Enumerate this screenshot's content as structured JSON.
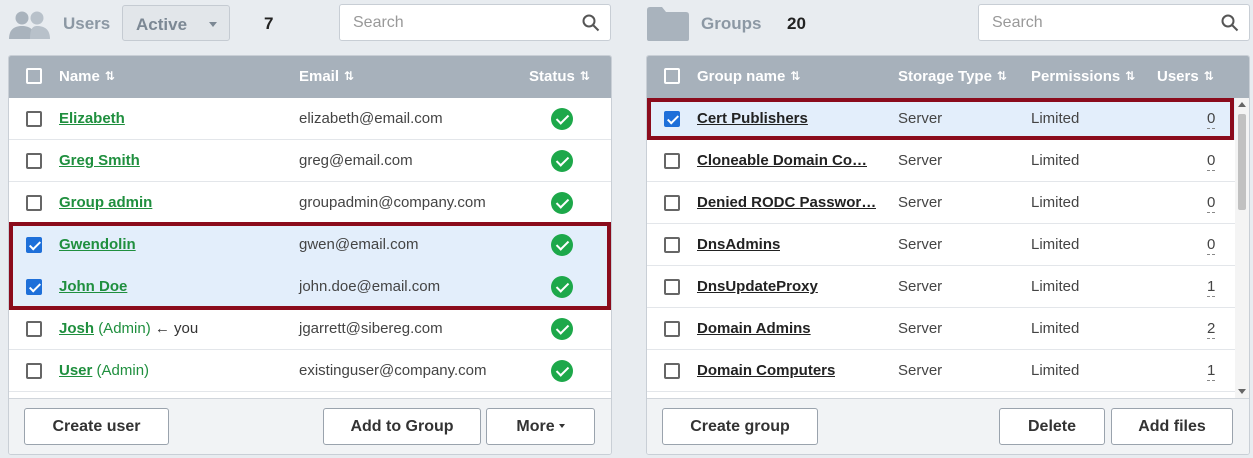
{
  "users_panel": {
    "title": "Users",
    "filter": {
      "selected": "Active"
    },
    "count": "7",
    "search": {
      "placeholder": "Search",
      "value": ""
    },
    "columns": {
      "name": "Name",
      "email": "Email",
      "status": "Status"
    },
    "rows": [
      {
        "name": "Elizabeth",
        "admin": "",
        "you": "",
        "email": "elizabeth@email.com",
        "checked": false,
        "status": "active"
      },
      {
        "name": "Greg Smith",
        "admin": "",
        "you": "",
        "email": "greg@email.com",
        "checked": false,
        "status": "active"
      },
      {
        "name": "Group admin",
        "admin": "",
        "you": "",
        "email": "groupadmin@company.com",
        "checked": false,
        "status": "active"
      },
      {
        "name": "Gwendolin",
        "admin": "",
        "you": "",
        "email": "gwen@email.com",
        "checked": true,
        "status": "active"
      },
      {
        "name": "John Doe",
        "admin": "",
        "you": "",
        "email": "john.doe@email.com",
        "checked": true,
        "status": "active"
      },
      {
        "name": "Josh",
        "admin": "(Admin)",
        "you": "← you",
        "email": "jgarrett@sibereg.com",
        "checked": false,
        "status": "active"
      },
      {
        "name": "User",
        "admin": "(Admin)",
        "you": "",
        "email": "existinguser@company.com",
        "checked": false,
        "status": "active"
      }
    ],
    "buttons": {
      "create": "Create user",
      "add_to_group": "Add to Group",
      "more": "More"
    }
  },
  "groups_panel": {
    "title": "Groups",
    "count": "20",
    "search": {
      "placeholder": "Search",
      "value": ""
    },
    "columns": {
      "name": "Group name",
      "storage": "Storage Type",
      "permissions": "Permissions",
      "users": "Users"
    },
    "rows": [
      {
        "name": "Cert Publishers",
        "storage": "Server",
        "permissions": "Limited",
        "users": "0",
        "checked": true
      },
      {
        "name": "Cloneable Domain Co…",
        "storage": "Server",
        "permissions": "Limited",
        "users": "0",
        "checked": false
      },
      {
        "name": "Denied RODC Passwor…",
        "storage": "Server",
        "permissions": "Limited",
        "users": "0",
        "checked": false
      },
      {
        "name": "DnsAdmins",
        "storage": "Server",
        "permissions": "Limited",
        "users": "0",
        "checked": false
      },
      {
        "name": "DnsUpdateProxy",
        "storage": "Server",
        "permissions": "Limited",
        "users": "1",
        "checked": false
      },
      {
        "name": "Domain Admins",
        "storage": "Server",
        "permissions": "Limited",
        "users": "2",
        "checked": false
      },
      {
        "name": "Domain Computers",
        "storage": "Server",
        "permissions": "Limited",
        "users": "1",
        "checked": false
      }
    ],
    "buttons": {
      "create": "Create group",
      "delete": "Delete",
      "add_files": "Add files"
    }
  },
  "colors": {
    "accent_green": "#1f8f3e",
    "selection_bg": "#e3eefb",
    "highlight_border": "#8b0b1c",
    "header_bg": "#a7b1bb",
    "checkbox_blue": "#1e6fd9"
  },
  "icons": {
    "users": "users-group-icon",
    "groups": "folder-icon",
    "search": "search-icon",
    "sort": "sort-icon",
    "status": "check-circle-icon"
  }
}
